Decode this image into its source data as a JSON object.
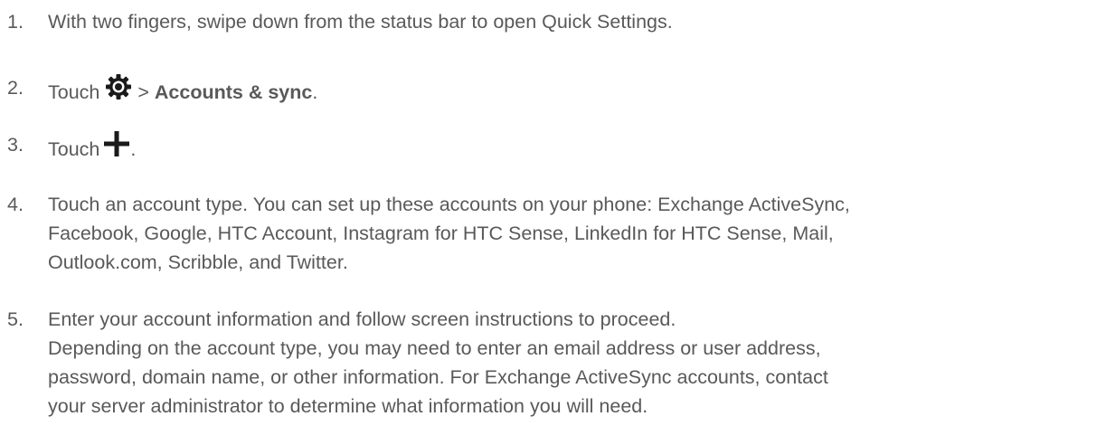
{
  "steps": [
    {
      "number": "1.",
      "text": "With two fingers, swipe down from the status bar to open Quick Settings."
    },
    {
      "number": "2.",
      "prefix": "Touch",
      "icon": "gear-icon",
      "separator": ">",
      "bold": "Accounts & sync",
      "suffix": "."
    },
    {
      "number": "3.",
      "prefix": "Touch",
      "icon": "plus-icon",
      "suffix": "."
    },
    {
      "number": "4.",
      "lines": [
        "Touch an account type. You can set up these accounts on your phone: Exchange ActiveSync,",
        "Facebook, Google, HTC Account, Instagram for HTC Sense, LinkedIn for HTC Sense, Mail,",
        "Outlook.com, Scribble, and Twitter."
      ]
    },
    {
      "number": "5.",
      "lines": [
        "Enter your account information and follow screen instructions to proceed.",
        "Depending on the account type, you may need to enter an email address or user address,",
        "password, domain name, or other information. For Exchange ActiveSync accounts, contact",
        "your server administrator to determine what information you will need."
      ]
    }
  ],
  "colors": {
    "text": "#595959",
    "icon": "#1a1a1a"
  }
}
